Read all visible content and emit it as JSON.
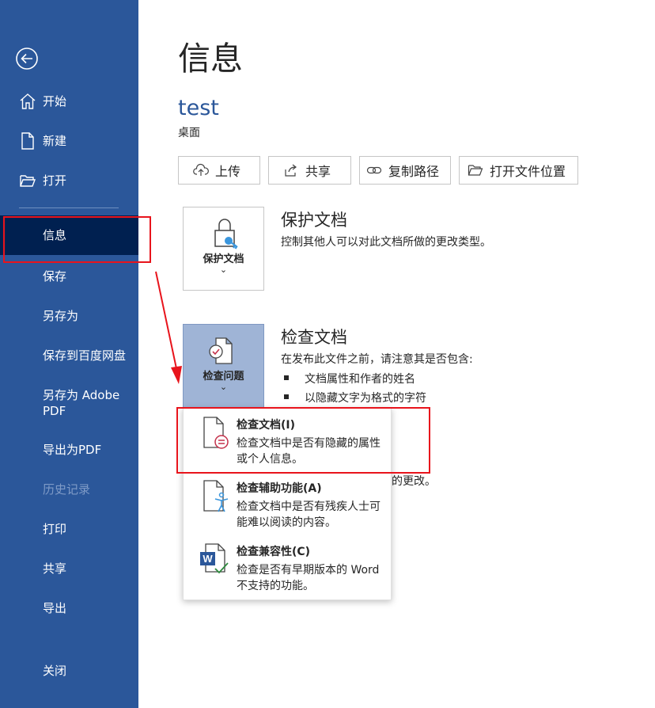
{
  "sidebar": {
    "items": [
      {
        "label": "开始",
        "icon": "home-icon"
      },
      {
        "label": "新建",
        "icon": "new-document-icon"
      },
      {
        "label": "打开",
        "icon": "open-folder-icon"
      },
      {
        "label": "信息",
        "active": true
      },
      {
        "label": "保存"
      },
      {
        "label": "另存为"
      },
      {
        "label": "保存到百度网盘"
      },
      {
        "label": "另存为 Adobe PDF"
      },
      {
        "label": "导出为PDF"
      },
      {
        "label": "历史记录",
        "disabled": true
      },
      {
        "label": "打印"
      },
      {
        "label": "共享"
      },
      {
        "label": "导出"
      },
      {
        "label": "关闭"
      }
    ]
  },
  "main": {
    "title": "信息",
    "doc_name": "test",
    "doc_location": "桌面",
    "actions": [
      {
        "label": "上传",
        "icon": "upload-cloud-icon"
      },
      {
        "label": "共享",
        "icon": "share-icon"
      },
      {
        "label": "复制路径",
        "icon": "link-icon"
      },
      {
        "label": "打开文件位置",
        "icon": "folder-open-icon"
      }
    ],
    "protect": {
      "tile_label": "保护文档",
      "title": "保护文档",
      "description": "控制其他人可以对此文档所做的更改类型。"
    },
    "inspect": {
      "tile_label": "检查问题",
      "title": "检查文档",
      "description": "在发布此文件之前，请注意其是否包含:",
      "bullets": [
        "文档属性和作者的姓名",
        "以隐藏文字为格式的字符"
      ],
      "partial_text": "的更改。"
    }
  },
  "dropdown": {
    "items": [
      {
        "title": "检查文档(I)",
        "description": "检查文档中是否有隐藏的属性或个人信息。",
        "icon": "inspect-document-icon"
      },
      {
        "title": "检查辅助功能(A)",
        "description": "检查文档中是否有残疾人士可能难以阅读的内容。",
        "icon": "accessibility-icon"
      },
      {
        "title": "检查兼容性(C)",
        "description": "检查是否有早期版本的 Word 不支持的功能。",
        "icon": "word-compatibility-icon"
      }
    ]
  },
  "colors": {
    "sidebar_bg": "#2b579a",
    "sidebar_active": "#002050",
    "accent": "#2b579a",
    "annotation_red": "#e8141c",
    "inspect_tile_bg": "#9fb4d6"
  }
}
